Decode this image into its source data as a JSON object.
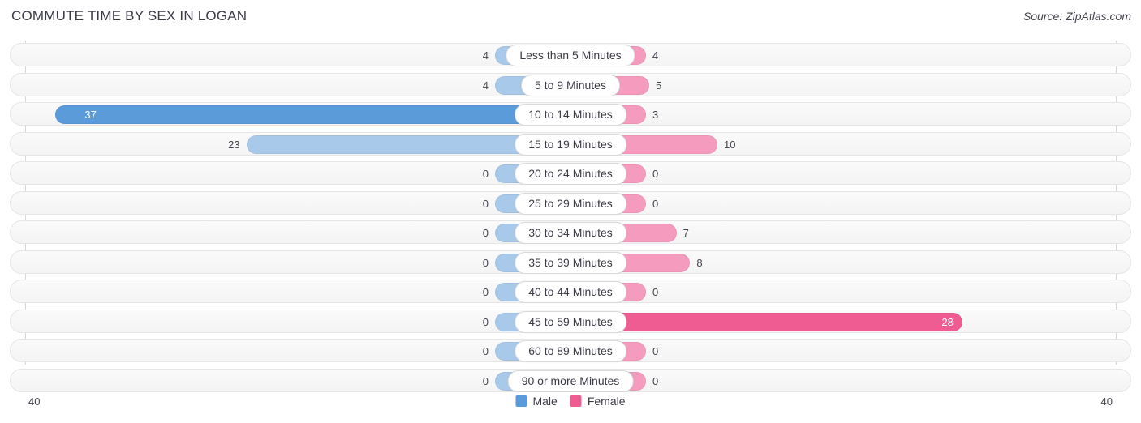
{
  "header": {
    "title": "COMMUTE TIME BY SEX IN LOGAN",
    "source": "Source: ZipAtlas.com"
  },
  "axis": {
    "left_label": "40",
    "right_label": "40"
  },
  "legend": {
    "male": "Male",
    "female": "Female"
  },
  "colors": {
    "male": "#5b9bd9",
    "male_light": "#a9c9ea",
    "female": "#ee5c92",
    "female_light": "#f59cbe"
  },
  "chart_data": {
    "type": "bar",
    "title": "COMMUTE TIME BY SEX IN LOGAN",
    "orientation": "horizontal-diverging",
    "xlabel": "",
    "ylabel": "",
    "xlim": [
      40,
      40
    ],
    "axis_max": 40,
    "grid": false,
    "legend_position": "bottom-center",
    "categories": [
      "Less than 5 Minutes",
      "5 to 9 Minutes",
      "10 to 14 Minutes",
      "15 to 19 Minutes",
      "20 to 24 Minutes",
      "25 to 29 Minutes",
      "30 to 34 Minutes",
      "35 to 39 Minutes",
      "40 to 44 Minutes",
      "45 to 59 Minutes",
      "60 to 89 Minutes",
      "90 or more Minutes"
    ],
    "series": [
      {
        "name": "Male",
        "values": [
          4,
          4,
          37,
          23,
          0,
          0,
          0,
          0,
          0,
          0,
          0,
          0
        ]
      },
      {
        "name": "Female",
        "values": [
          4,
          5,
          3,
          10,
          0,
          0,
          7,
          8,
          0,
          28,
          0,
          0
        ]
      }
    ]
  },
  "rows": [
    {
      "category": "Less than 5 Minutes",
      "male": "4",
      "female": "4"
    },
    {
      "category": "5 to 9 Minutes",
      "male": "4",
      "female": "5"
    },
    {
      "category": "10 to 14 Minutes",
      "male": "37",
      "female": "3"
    },
    {
      "category": "15 to 19 Minutes",
      "male": "23",
      "female": "10"
    },
    {
      "category": "20 to 24 Minutes",
      "male": "0",
      "female": "0"
    },
    {
      "category": "25 to 29 Minutes",
      "male": "0",
      "female": "0"
    },
    {
      "category": "30 to 34 Minutes",
      "male": "0",
      "female": "7"
    },
    {
      "category": "35 to 39 Minutes",
      "male": "0",
      "female": "8"
    },
    {
      "category": "40 to 44 Minutes",
      "male": "0",
      "female": "0"
    },
    {
      "category": "45 to 59 Minutes",
      "male": "0",
      "female": "28"
    },
    {
      "category": "60 to 89 Minutes",
      "male": "0",
      "female": "0"
    },
    {
      "category": "90 or more Minutes",
      "male": "0",
      "female": "0"
    }
  ]
}
